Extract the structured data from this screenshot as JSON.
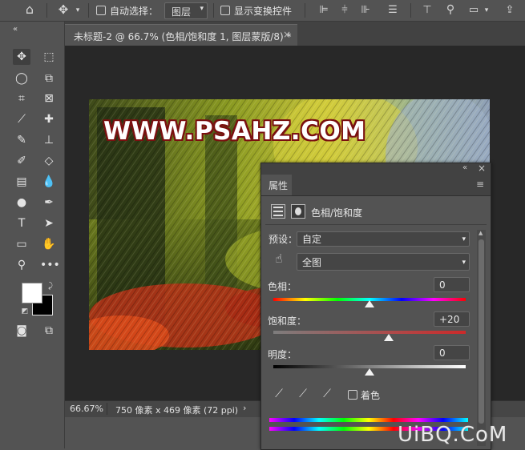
{
  "options_bar": {
    "auto_select_label": "自动选择：",
    "layer_select_value": "图层",
    "show_transform_label": "显示变换控件"
  },
  "document": {
    "tab_title": "未标题-2 @ 66.7% (色相/饱和度 1, 图层蒙版/8) *",
    "zoom": "66.67%",
    "doc_info": "750 像素 x 469 像素 (72 ppi)"
  },
  "image": {
    "watermark_text": "WWW.PSAHZ.COM"
  },
  "properties": {
    "panel_title": "属性",
    "adjustment_title": "色相/饱和度",
    "preset_label": "预设：",
    "preset_value": "自定",
    "channel_value": "全图",
    "hue_label": "色相：",
    "hue_value": "0",
    "saturation_label": "饱和度：",
    "saturation_value": "+20",
    "lightness_label": "明度：",
    "lightness_value": "0",
    "colorize_label": "着色",
    "hue_level": 0.5,
    "saturation_level": 0.6,
    "lightness_level": 0.5
  },
  "site_watermark": "UiBQ.CoM"
}
